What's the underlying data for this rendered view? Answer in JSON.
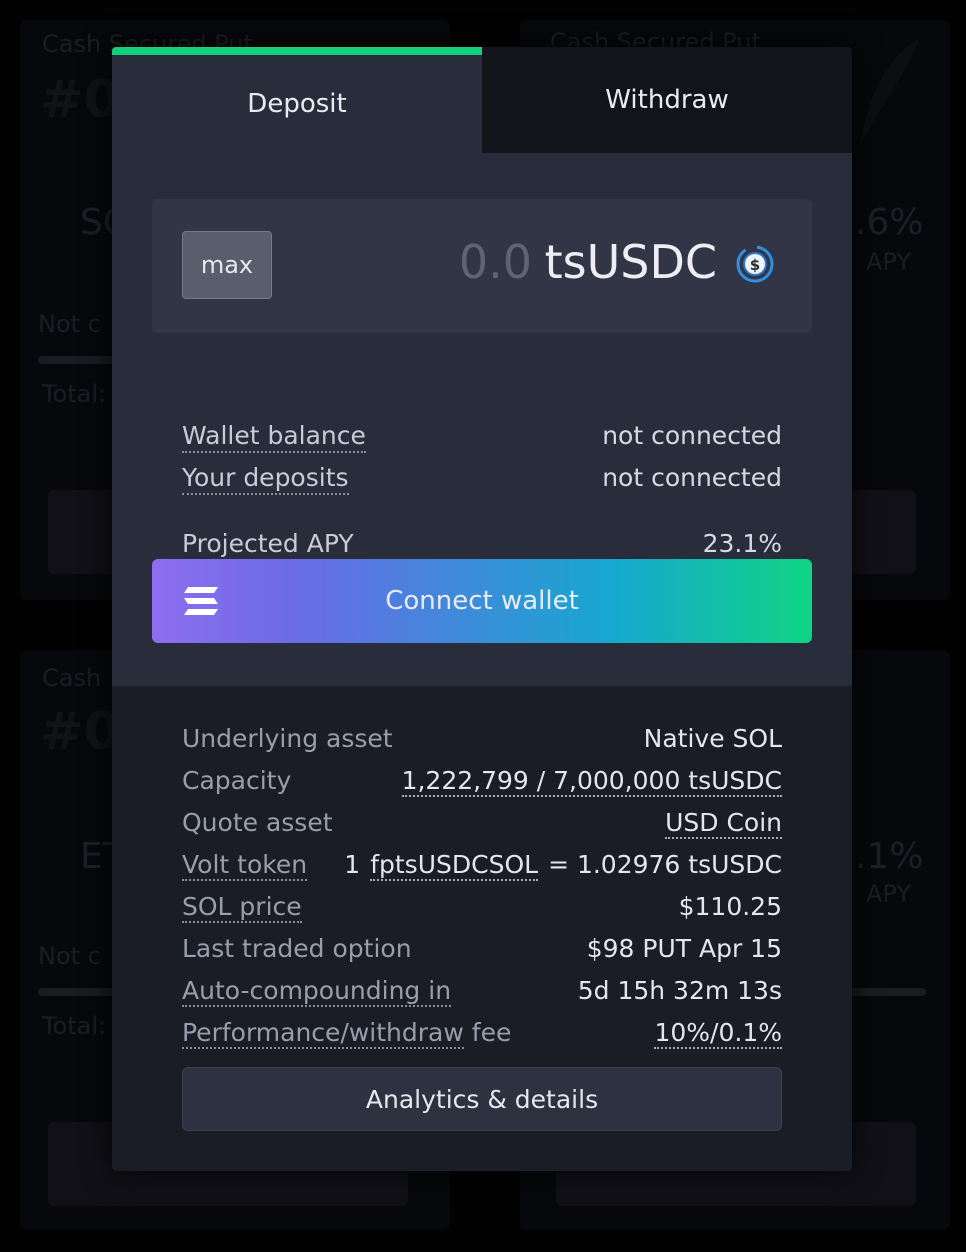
{
  "background": {
    "card_title": "Cash Secured Put",
    "left_top": {
      "number": "#0",
      "asset": "SO",
      "status": "Not c",
      "total": "Total:"
    },
    "right_top": {
      "apy": ".6%",
      "apy_label": "APY"
    },
    "left_bottom": {
      "title": "Cash",
      "number": "#0",
      "asset": "ET",
      "status": "Not c",
      "total": "Total:"
    },
    "right_bottom": {
      "apy": ".1%",
      "apy_label": "APY"
    }
  },
  "tabs": {
    "deposit": "Deposit",
    "withdraw": "Withdraw",
    "active": "Deposit"
  },
  "amount": {
    "max_label": "max",
    "value": "0.0",
    "token": "tsUSDC",
    "token_icon": "usdc-coin-icon"
  },
  "summary": {
    "wallet_balance_label": "Wallet balance",
    "wallet_balance_value": "not connected",
    "your_deposits_label": "Your deposits",
    "your_deposits_value": "not connected",
    "projected_apy_label": "Projected APY",
    "projected_apy_value": "23.1%"
  },
  "connect": {
    "label": "Connect wallet",
    "icon": "solana-icon"
  },
  "details": {
    "underlying_asset_label": "Underlying asset",
    "underlying_asset_value": "Native SOL",
    "capacity_label": "Capacity",
    "capacity_value": "1,222,799 / 7,000,000 tsUSDC",
    "quote_asset_label": "Quote asset",
    "quote_asset_value": "USD Coin",
    "volt_token_label": "Volt token",
    "volt_token_prefix": "1",
    "volt_token_symbol": "fptsUSDCSOL",
    "volt_token_suffix": "= 1.02976 tsUSDC",
    "sol_price_label": "SOL price",
    "sol_price_value": "$110.25",
    "last_traded_label": "Last traded option",
    "last_traded_value": "$98 PUT Apr 15",
    "autocompound_label": "Auto-compounding in",
    "autocompound_value": "5d 15h 32m 13s",
    "fee_label_underlined": "Performance/withdraw",
    "fee_label_suffix": "fee",
    "fee_value": "10%/0.1%"
  },
  "analytics_button": "Analytics & details",
  "colors": {
    "accent_green": "#14d07b",
    "gradient_start": "#6a6be6",
    "gradient_end": "#10d484"
  }
}
